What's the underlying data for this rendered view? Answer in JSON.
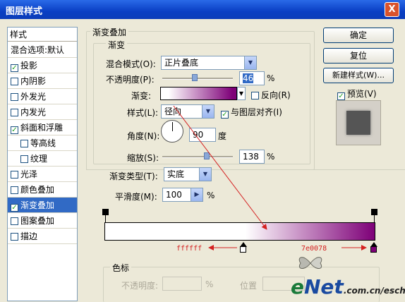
{
  "window": {
    "title": "图层样式",
    "close_glyph": "X"
  },
  "left_panel": {
    "header": "样式",
    "items": [
      {
        "label": "混合选项:默认",
        "checkbox": false,
        "checked": false,
        "selected": false
      },
      {
        "label": "投影",
        "checkbox": true,
        "checked": true,
        "selected": false
      },
      {
        "label": "内阴影",
        "checkbox": true,
        "checked": false,
        "selected": false
      },
      {
        "label": "外发光",
        "checkbox": true,
        "checked": false,
        "selected": false
      },
      {
        "label": "内发光",
        "checkbox": true,
        "checked": false,
        "selected": false
      },
      {
        "label": "斜面和浮雕",
        "checkbox": true,
        "checked": true,
        "selected": false
      },
      {
        "label": "等高线",
        "checkbox": true,
        "checked": false,
        "selected": false,
        "indent": true
      },
      {
        "label": "纹理",
        "checkbox": true,
        "checked": false,
        "selected": false,
        "indent": true
      },
      {
        "label": "光泽",
        "checkbox": true,
        "checked": false,
        "selected": false
      },
      {
        "label": "颜色叠加",
        "checkbox": true,
        "checked": false,
        "selected": false
      },
      {
        "label": "渐变叠加",
        "checkbox": true,
        "checked": true,
        "selected": true
      },
      {
        "label": "图案叠加",
        "checkbox": true,
        "checked": false,
        "selected": false
      },
      {
        "label": "描边",
        "checkbox": true,
        "checked": false,
        "selected": false
      }
    ]
  },
  "overlay": {
    "group_title": "渐变叠加",
    "sub_group_title": "渐变",
    "blend_mode": {
      "label": "混合模式(O):",
      "value": "正片叠底"
    },
    "opacity": {
      "label": "不透明度(P):",
      "value": "46",
      "unit": "%",
      "level": 0.46
    },
    "gradient": {
      "label": "渐变:",
      "reverse_label": "反向(R)",
      "reverse_checked": false
    },
    "style": {
      "label": "样式(L):",
      "value": "径向",
      "align_label": "与图层对齐(I)",
      "align_checked": true
    },
    "angle": {
      "label": "角度(N):",
      "value": "90",
      "unit": "度"
    },
    "scale": {
      "label": "缩放(S):",
      "value": "138",
      "unit": "%",
      "level": 0.63
    }
  },
  "buttons": {
    "ok": "确定",
    "reset": "复位",
    "new_style": "新建样式(W)...",
    "preview_label": "预览(V)",
    "preview_checked": true
  },
  "gradient_editor": {
    "type_label": "渐变类型(T):",
    "type_value": "实底",
    "smoothness_label": "平滑度(M):",
    "smoothness_value": "100",
    "smoothness_unit": "%",
    "color_start": "#ffffff",
    "color_end": "#7e0078",
    "start_hex": "ffffff",
    "end_hex": "7e0078",
    "midpoint_location": 0.37,
    "stops_title": "色标",
    "stop_opacity_label": "不透明度:",
    "stop_opacity_unit": "%",
    "stop_location_label": "位置"
  },
  "watermark": {
    "text": "eNet.com.cn/eschool"
  }
}
